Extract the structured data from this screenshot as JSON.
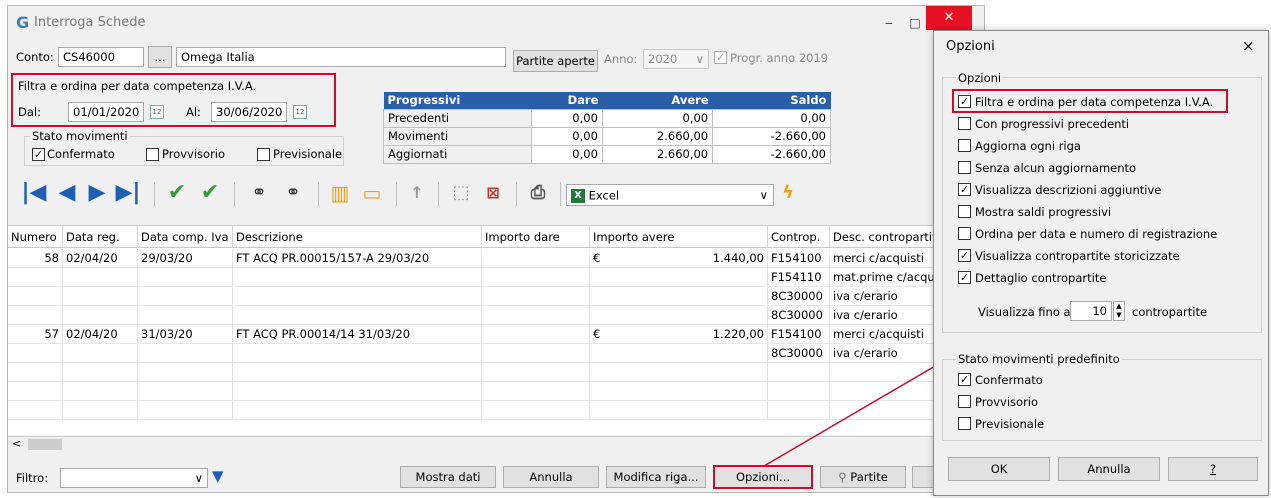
{
  "window": {
    "title": "Interroga Schede",
    "logo": "G",
    "minimize": "‒",
    "maximize": "□",
    "close": "✕"
  },
  "conto": {
    "label": "Conto:",
    "code": "CS46000",
    "browse": "...",
    "name": "Omega Italia"
  },
  "partite_aperte": "Partite aperte",
  "anno": {
    "label": "Anno:",
    "value": "2020",
    "arrow": "∨"
  },
  "progr": {
    "label": "Progr. anno 2019",
    "checked": "✓"
  },
  "filtro_data": {
    "title": "Filtra e ordina per data competenza I.V.A.",
    "dal_label": "Dal:",
    "dal_value": "01/01/2020",
    "al_label": "Al:",
    "al_value": "30/06/2020",
    "cal": "12"
  },
  "stato": {
    "title": "Stato movimenti",
    "items": [
      {
        "label": "Confermato",
        "mark": "✓"
      },
      {
        "label": "Provvisorio",
        "mark": ""
      },
      {
        "label": "Previsionale",
        "mark": ""
      }
    ]
  },
  "progressivi": {
    "headers": [
      "Progressivi",
      "Dare",
      "Avere",
      "Saldo"
    ],
    "rows": [
      [
        "Precedenti",
        "0,00",
        "0,00",
        "0,00"
      ],
      [
        "Movimenti",
        "0,00",
        "2.660,00",
        "-2.660,00"
      ],
      [
        "Aggiornati",
        "0,00",
        "2.660,00",
        "-2.660,00"
      ]
    ]
  },
  "toolbar": {
    "first": "|◀",
    "prev": "◀",
    "next": "▶",
    "last": "▶|",
    "excel_icon": "X",
    "excel_label": "Excel",
    "dropdown": "∨",
    "lightning": "ϟ",
    "colors": {
      "blue": "#1e5fb4",
      "green": "#3a9a3a",
      "orange": "#f39c12"
    }
  },
  "grid": {
    "headers": [
      "Numero",
      "Data reg.",
      "Data comp. Iva",
      "Descrizione",
      "Importo dare",
      "Importo avere",
      "Controp.",
      "Desc. contropartita"
    ],
    "rows": [
      [
        "58",
        "02/04/20",
        "29/03/20",
        "FT ACQ PR.00015/157-A 29/03/20",
        "",
        "€",
        "1.440,00",
        "F154100",
        "merci c/acquisti"
      ],
      [
        "",
        "",
        "",
        "",
        "",
        "",
        "",
        "F154110",
        "mat.prime c/acquisti"
      ],
      [
        "",
        "",
        "",
        "",
        "",
        "",
        "",
        "8C30000",
        "iva c/erario"
      ],
      [
        "",
        "",
        "",
        "",
        "",
        "",
        "",
        "8C30000",
        "iva c/erario"
      ],
      [
        "57",
        "02/04/20",
        "31/03/20",
        "FT ACQ PR.00014/14 31/03/20",
        "",
        "€",
        "1.220,00",
        "F154100",
        "merci c/acquisti"
      ],
      [
        "",
        "",
        "",
        "",
        "",
        "",
        "",
        "8C30000",
        "iva c/erario"
      ],
      [
        "",
        "",
        "",
        "",
        "",
        "",
        "",
        "",
        ""
      ],
      [
        "",
        "",
        "",
        "",
        "",
        "",
        "",
        "",
        ""
      ],
      [
        "",
        "",
        "",
        "",
        "",
        "",
        "",
        "",
        ""
      ]
    ],
    "scroll_left": "<"
  },
  "footer": {
    "filtro_label": "Filtro:",
    "filtro_arrow": "∨",
    "buttons": {
      "mostra_dati": "Mostra dati",
      "annulla": "Annulla",
      "modifica_riga": "Modifica riga...",
      "opzioni": "Opzioni...",
      "partite": "Partite"
    }
  },
  "options": {
    "title": "Opzioni",
    "close": "×",
    "group1_title": "Opzioni",
    "items": [
      {
        "label": "Filtra e ordina per data competenza I.V.A.",
        "mark": "✓"
      },
      {
        "label": "Con progressivi precedenti",
        "mark": ""
      },
      {
        "label": "Aggiorna ogni riga",
        "mark": ""
      },
      {
        "label": "Senza alcun aggiornamento",
        "mark": ""
      },
      {
        "label": "Visualizza descrizioni aggiuntive",
        "mark": "✓"
      },
      {
        "label": "Mostra saldi progressivi",
        "mark": ""
      },
      {
        "label": "Ordina per data e numero di registrazione",
        "mark": ""
      },
      {
        "label": "Visualizza contropartite storicizzate",
        "mark": "✓"
      },
      {
        "label": "Dettaglio contropartite",
        "mark": "✓"
      }
    ],
    "visualizza_fino": {
      "label": "Visualizza fino a",
      "value": "10",
      "suffix": "contropartite"
    },
    "group2_title": "Stato movimenti predefinito",
    "stato_items": [
      {
        "label": "Confermato",
        "mark": "✓"
      },
      {
        "label": "Provvisorio",
        "mark": ""
      },
      {
        "label": "Previsionale",
        "mark": ""
      }
    ],
    "buttons": {
      "ok": "OK",
      "annulla": "Annulla",
      "help": "?"
    }
  }
}
